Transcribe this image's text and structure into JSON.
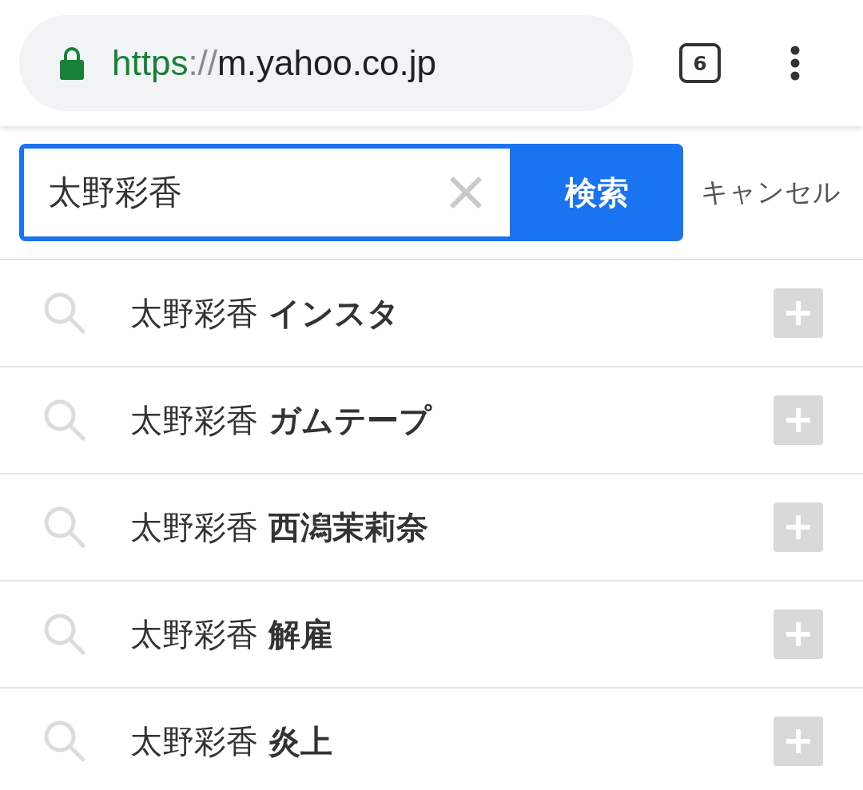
{
  "toolbar": {
    "url": {
      "scheme": "https",
      "separator": "://",
      "host": "m.yahoo.co.jp"
    },
    "tab_count": "6"
  },
  "search": {
    "value": "太野彩香",
    "button": "検索",
    "cancel": "キャンセル"
  },
  "suggestions": [
    {
      "text": "太野彩香 **インスタ**"
    },
    {
      "text": "太野彩香 **ガムテープ**"
    },
    {
      "text": "太野彩香 **西潟茉莉奈**"
    },
    {
      "text": "太野彩香 **解雇**"
    },
    {
      "text": "太野彩香 **炎上**"
    }
  ]
}
